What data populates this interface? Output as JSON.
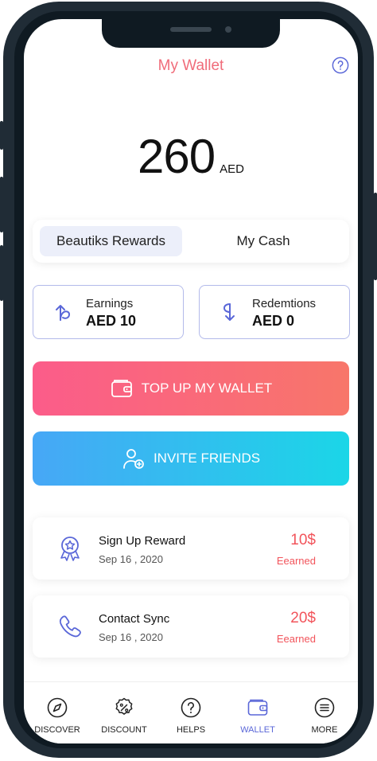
{
  "header": {
    "title": "My Wallet",
    "help_icon": "question-circle-icon"
  },
  "balance": {
    "amount": "260",
    "currency": "AED"
  },
  "tabs": [
    {
      "label": "Beautiks Rewards",
      "active": true
    },
    {
      "label": "My Cash",
      "active": false
    }
  ],
  "stats": {
    "earnings": {
      "label": "Earnings",
      "value": "AED 10",
      "icon": "arrow-up-curved-icon"
    },
    "redemptions": {
      "label": "Redemtions",
      "value": "AED 0",
      "icon": "arrow-down-curved-icon"
    }
  },
  "actions": {
    "topup": {
      "label": "TOP UP MY WALLET",
      "icon": "wallet-icon"
    },
    "invite": {
      "label": "INVITE FRIENDS",
      "icon": "user-add-icon"
    }
  },
  "rewards": [
    {
      "title": "Sign Up Reward",
      "date": "Sep 16 , 2020",
      "amount": "10$",
      "status": "Eearned",
      "icon": "badge-icon"
    },
    {
      "title": "Contact Sync",
      "date": "Sep 16 , 2020",
      "amount": "20$",
      "status": "Eearned",
      "icon": "phone-icon"
    }
  ],
  "nav": [
    {
      "label": "DISCOVER",
      "icon": "compass-icon",
      "active": false
    },
    {
      "label": "DISCOUNT",
      "icon": "discount-icon",
      "active": false
    },
    {
      "label": "HELPS",
      "icon": "question-circle-icon",
      "active": false
    },
    {
      "label": "WALLET",
      "icon": "wallet-icon",
      "active": true
    },
    {
      "label": "MORE",
      "icon": "menu-icon",
      "active": false
    }
  ],
  "colors": {
    "accent": "#5a67d8",
    "title": "#f06c7a",
    "reward_amount": "#f2545b",
    "topup_gradient": [
      "#fb5c8a",
      "#f8766a"
    ],
    "invite_gradient": [
      "#47a7f6",
      "#1bd6e7"
    ]
  }
}
